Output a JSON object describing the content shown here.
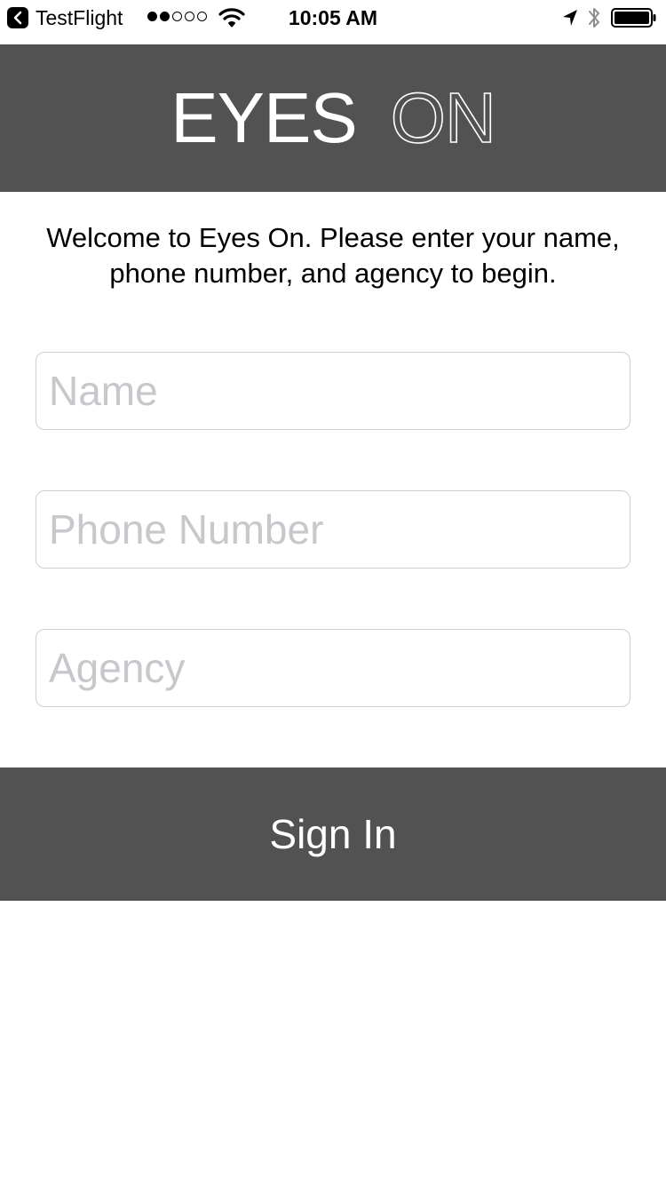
{
  "status_bar": {
    "back_app_label": "TestFlight",
    "back_icon": "chevron-left-icon",
    "signal_dots_filled": 2,
    "signal_dots_total": 5,
    "time": "10:05 AM",
    "icons": [
      "wifi-icon",
      "location-arrow-icon",
      "bluetooth-icon",
      "battery-icon"
    ]
  },
  "header": {
    "logo_bold": "EYES",
    "logo_thin": "ON",
    "background": "#525252"
  },
  "welcome": {
    "line1": "Welcome to Eyes On. Please enter your name,",
    "line2": "phone number, and agency to begin."
  },
  "form": {
    "name": {
      "value": "",
      "placeholder": "Name"
    },
    "phone": {
      "value": "",
      "placeholder": "Phone Number"
    },
    "agency": {
      "value": "",
      "placeholder": "Agency"
    }
  },
  "signin": {
    "label": "Sign In",
    "background": "#525252"
  }
}
